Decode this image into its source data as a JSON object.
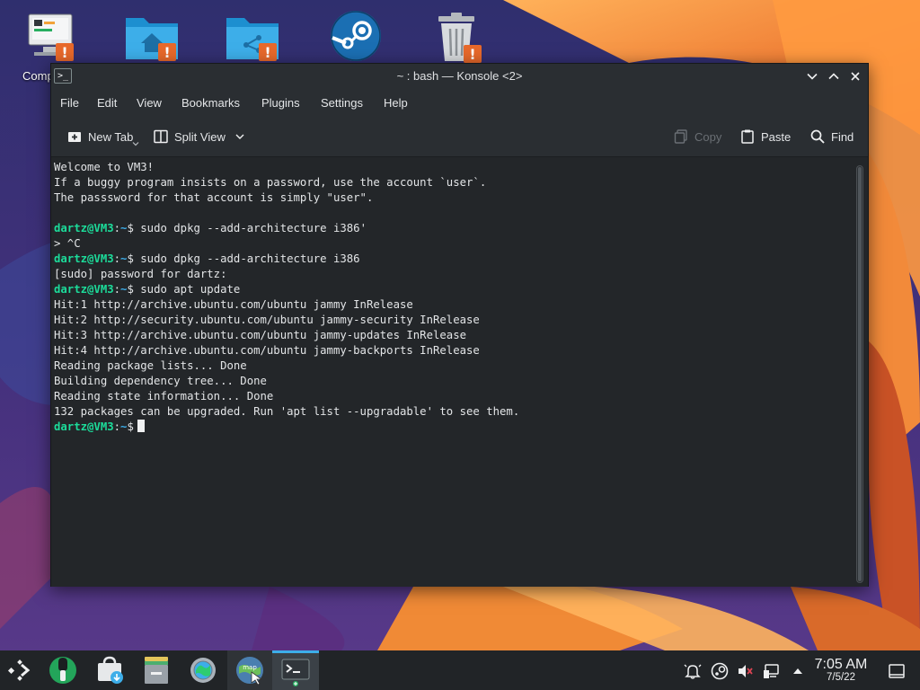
{
  "desktop": {
    "icons": [
      {
        "name": "computer",
        "label": "Comp"
      },
      {
        "name": "home-folder",
        "label": ""
      },
      {
        "name": "network-folder",
        "label": ""
      },
      {
        "name": "steam",
        "label": ""
      },
      {
        "name": "trash",
        "label": ""
      }
    ]
  },
  "window": {
    "title": "~ : bash — Konsole <2>",
    "app_icon_glyph": ">_"
  },
  "menubar": {
    "items": [
      "File",
      "Edit",
      "View",
      "Bookmarks",
      "Plugins",
      "Settings",
      "Help"
    ]
  },
  "toolbar": {
    "new_tab": "New Tab",
    "split_view": "Split View",
    "copy": "Copy",
    "paste": "Paste",
    "find": "Find"
  },
  "terminal": {
    "prompt_user": "dartz@VM3",
    "prompt_path": "~",
    "lines": [
      {
        "type": "text",
        "text": "Welcome to VM3!"
      },
      {
        "type": "text",
        "text": "If a buggy program insists on a password, use the account `user`."
      },
      {
        "type": "text",
        "text": "The passsword for that account is simply \"user\"."
      },
      {
        "type": "text",
        "text": ""
      },
      {
        "type": "prompt",
        "text": "sudo dpkg --add-architecture i386'"
      },
      {
        "type": "text",
        "text": "> ^C"
      },
      {
        "type": "prompt",
        "text": "sudo dpkg --add-architecture i386"
      },
      {
        "type": "text",
        "text": "[sudo] password for dartz:"
      },
      {
        "type": "prompt",
        "text": "sudo apt update"
      },
      {
        "type": "text",
        "text": "Hit:1 http://archive.ubuntu.com/ubuntu jammy InRelease"
      },
      {
        "type": "text",
        "text": "Hit:2 http://security.ubuntu.com/ubuntu jammy-security InRelease"
      },
      {
        "type": "text",
        "text": "Hit:3 http://archive.ubuntu.com/ubuntu jammy-updates InRelease"
      },
      {
        "type": "text",
        "text": "Hit:4 http://archive.ubuntu.com/ubuntu jammy-backports InRelease"
      },
      {
        "type": "text",
        "text": "Reading package lists... Done"
      },
      {
        "type": "text",
        "text": "Building dependency tree... Done"
      },
      {
        "type": "text",
        "text": "Reading state information... Done"
      },
      {
        "type": "text",
        "text": "132 packages can be upgraded. Run 'apt list --upgradable' to see them."
      },
      {
        "type": "prompt",
        "text": "",
        "cursor": true
      }
    ]
  },
  "taskbar": {
    "apps": [
      "application-launcher",
      "discover",
      "store",
      "dolphin",
      "system-settings",
      "map-app",
      "konsole"
    ],
    "active_app": "konsole",
    "clock": {
      "time": "7:05 AM",
      "date": "7/5/22"
    }
  },
  "colors": {
    "accent": "#3daee9",
    "prompt_user": "#1cdc9a",
    "warning_badge": "#e8692b"
  }
}
